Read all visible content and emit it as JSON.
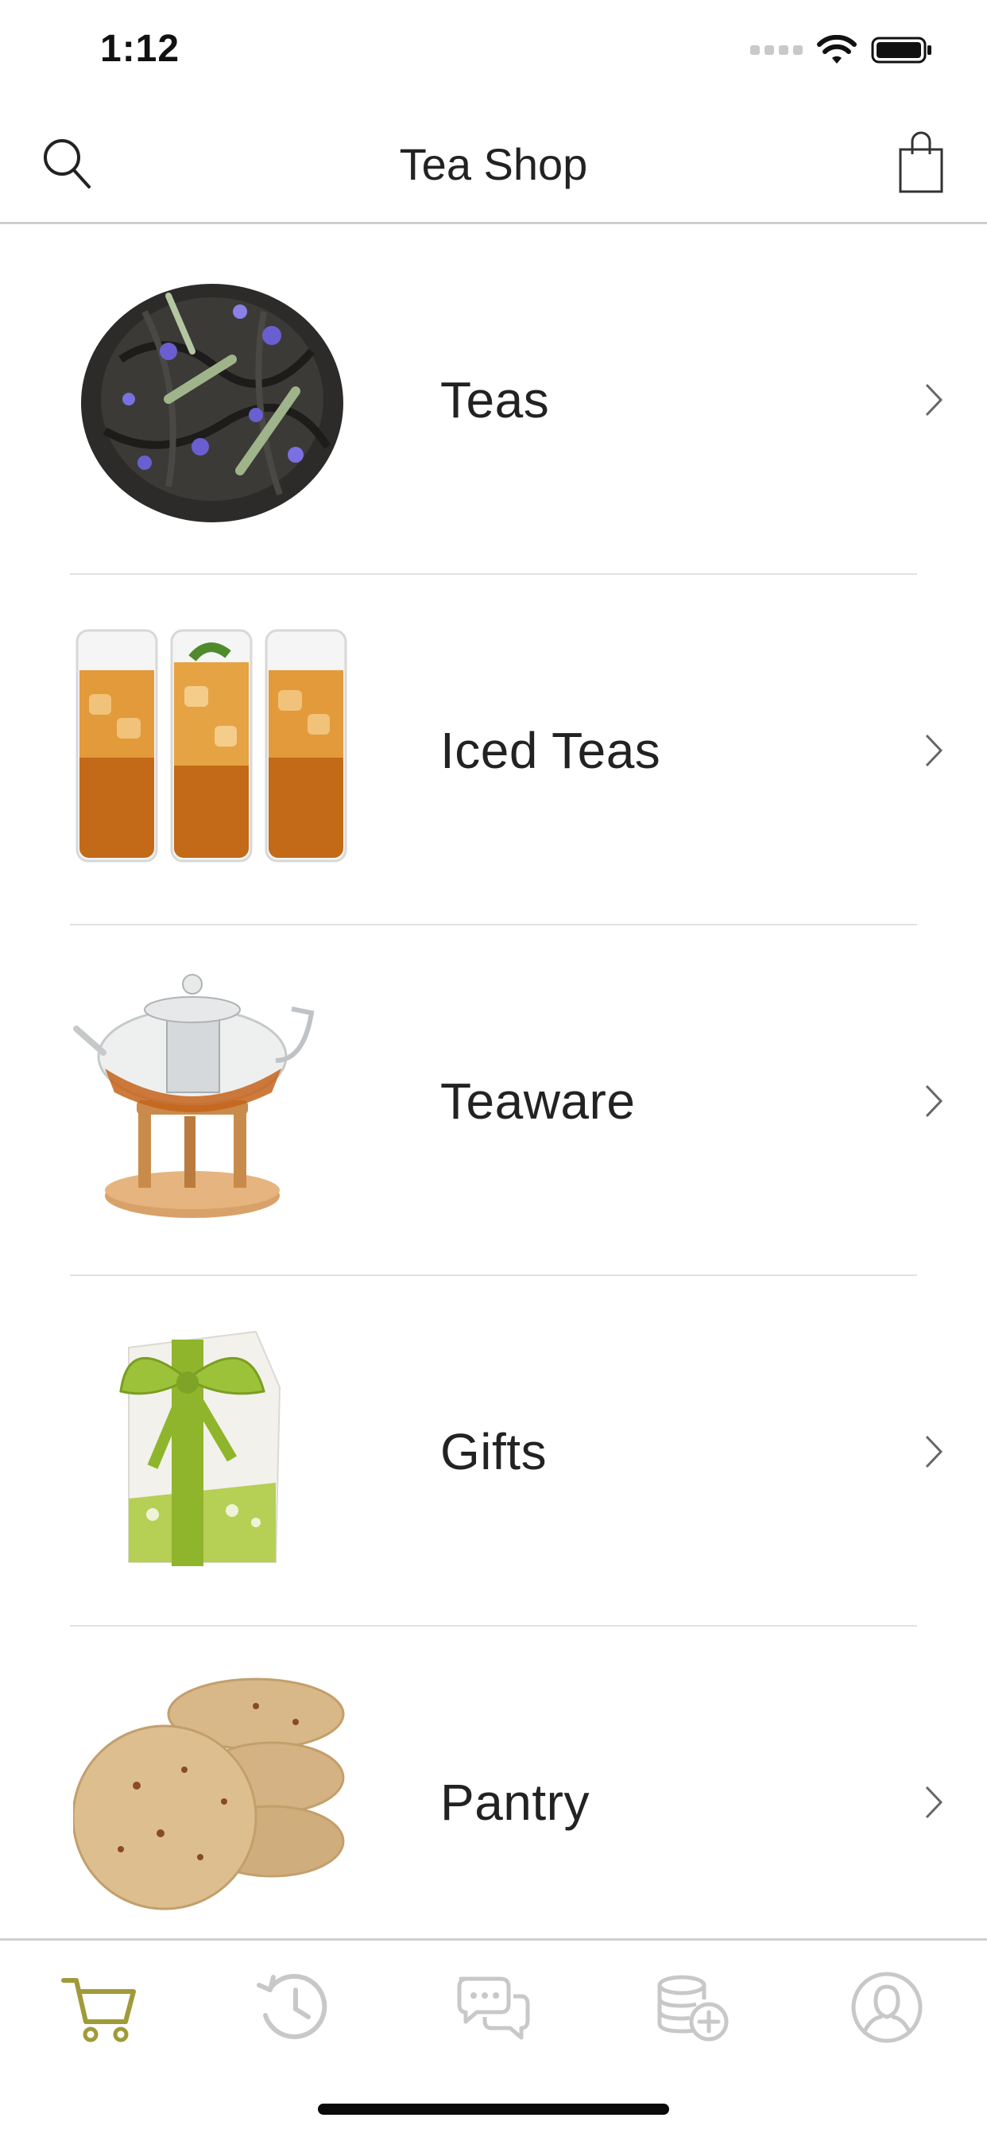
{
  "status_bar": {
    "time": "1:12"
  },
  "nav": {
    "title": "Tea Shop",
    "search_icon": "search-icon",
    "bag_icon": "shopping-bag-icon"
  },
  "categories": [
    {
      "label": "Teas",
      "image": "loose-leaf-tea-photo"
    },
    {
      "label": "Iced Teas",
      "image": "iced-tea-glasses-photo"
    },
    {
      "label": "Teaware",
      "image": "glass-teapot-warmer-photo"
    },
    {
      "label": "Gifts",
      "image": "gift-box-green-ribbon-photo"
    },
    {
      "label": "Pantry",
      "image": "cookies-photo"
    }
  ],
  "tab_bar": {
    "items": [
      {
        "name": "shop",
        "icon": "cart-icon",
        "active": true
      },
      {
        "name": "history",
        "icon": "history-icon",
        "active": false
      },
      {
        "name": "messages",
        "icon": "chat-bubbles-icon",
        "active": false
      },
      {
        "name": "add-funds",
        "icon": "coins-plus-icon",
        "active": false
      },
      {
        "name": "account",
        "icon": "user-profile-icon",
        "active": false
      }
    ],
    "active_color": "#a09a3a",
    "inactive_color": "#c8c8c8"
  }
}
